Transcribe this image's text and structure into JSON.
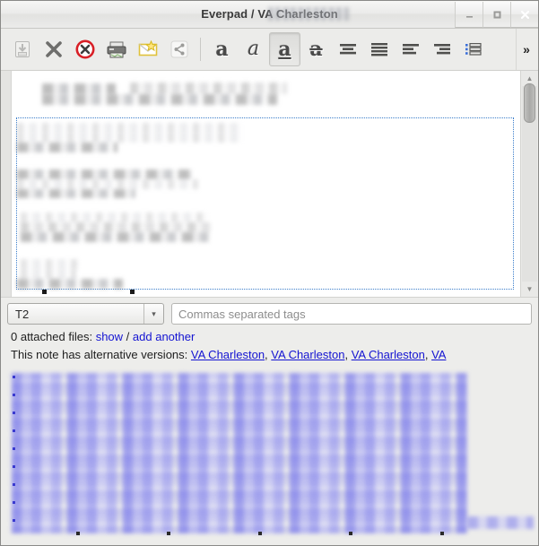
{
  "window": {
    "title": "Everpad / VA Charleston",
    "controls": [
      {
        "name": "minimize",
        "glyph": "minimize-icon"
      },
      {
        "name": "maximize",
        "glyph": "maximize-icon"
      },
      {
        "name": "close",
        "glyph": "close-icon"
      }
    ]
  },
  "toolbar": {
    "overflow_label": "»",
    "items": [
      {
        "name": "save-icon",
        "label": "Save",
        "state": "disabled"
      },
      {
        "name": "close-note-icon",
        "label": "Close",
        "state": "normal"
      },
      {
        "name": "delete-icon",
        "label": "Delete",
        "state": "normal"
      },
      {
        "name": "print-icon",
        "label": "Print",
        "state": "normal"
      },
      {
        "name": "email-icon",
        "label": "Send by email",
        "state": "normal"
      },
      {
        "name": "share-icon",
        "label": "Share",
        "state": "disabled"
      },
      {
        "name": "bold-icon",
        "label": "Bold",
        "glyph": "a",
        "state": "normal"
      },
      {
        "name": "italic-icon",
        "label": "Italic",
        "glyph": "a",
        "state": "normal"
      },
      {
        "name": "underline-icon",
        "label": "Underline",
        "glyph": "a",
        "state": "pressed"
      },
      {
        "name": "strikethrough-icon",
        "label": "Strikethrough",
        "glyph": "a",
        "state": "normal"
      },
      {
        "name": "align-center-icon",
        "label": "Align center",
        "state": "normal"
      },
      {
        "name": "align-justify-icon",
        "label": "Justify",
        "state": "normal"
      },
      {
        "name": "align-left-icon",
        "label": "Align left",
        "state": "normal"
      },
      {
        "name": "align-right-icon",
        "label": "Align right",
        "state": "normal"
      },
      {
        "name": "bullet-list-icon",
        "label": "Bulleted list",
        "state": "normal"
      }
    ]
  },
  "editor": {
    "content_note": "redacted note body",
    "scrollbar": {
      "up": "▲",
      "down": "▼"
    }
  },
  "form": {
    "notebook": {
      "value": "T2",
      "arrow": "▾"
    },
    "tags": {
      "value": "",
      "placeholder": "Commas separated tags"
    }
  },
  "attachments": {
    "count_text": "0 attached files:",
    "show_link": "show",
    "separator": "/",
    "add_link": "add another"
  },
  "alternatives": {
    "label": "This note has alternative versions:",
    "links": [
      {
        "text": "VA Charleston",
        "suffix": ","
      },
      {
        "text": "VA Charleston",
        "suffix": ","
      },
      {
        "text": "VA Charleston",
        "suffix": ","
      },
      {
        "text": "VA",
        "suffix": ""
      }
    ]
  },
  "colors": {
    "link": "#1414d2",
    "selection_border": "#3b7ecb",
    "chrome": "#ececea",
    "editor_bg": "#ffffff",
    "blur_blue": "#7a7aeb"
  }
}
